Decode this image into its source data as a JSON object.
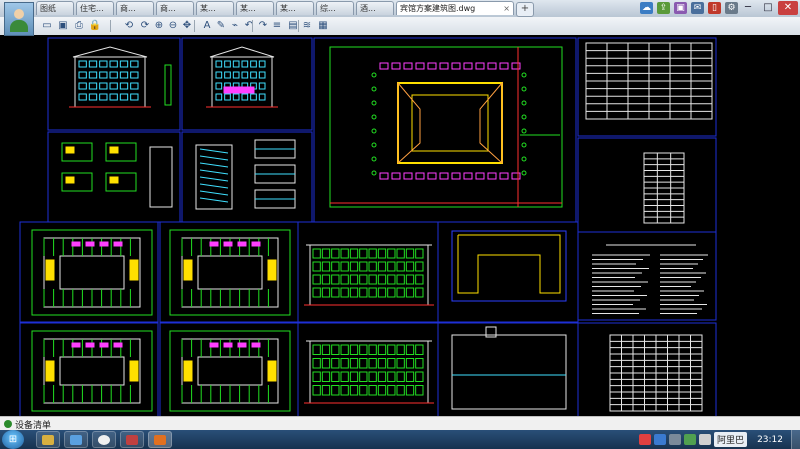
{
  "window": {
    "tabs": [
      "图纸",
      "住宅...",
      "商...",
      "商...",
      "某...",
      "某...",
      "某...",
      "综...",
      "酒..."
    ],
    "active_tab": "宾馆方案建筑图.dwg",
    "new_tab": "+",
    "controls": {
      "minimize": "─",
      "maximize": "□",
      "close": "✕"
    }
  },
  "toolbar": {
    "icons": [
      "open-icon",
      "save-icon",
      "print-icon",
      "lock-icon",
      "rotate-icon",
      "rotate-right-icon",
      "zoom-in-icon",
      "zoom-out-icon",
      "pan-icon",
      "text-icon",
      "pencil-icon",
      "brush-icon",
      "undo-icon",
      "redo-icon",
      "layer-icon",
      "layout-icon",
      "measure-icon",
      "block-icon"
    ],
    "glyphs": [
      "▭",
      "▣",
      "⎙",
      "🔒",
      "⟲",
      "⟳",
      "⊕",
      "⊖",
      "✥",
      "A",
      "✎",
      "⌁",
      "↶",
      "↷",
      "≡",
      "▤",
      "≋",
      "▦"
    ]
  },
  "drawing": {
    "background": "#000000",
    "border_color": "#1e2fd6",
    "line_colors": {
      "green": "#22e022",
      "white": "#e6e6e6",
      "yellow": "#ffe000",
      "magenta": "#ff40ff",
      "cyan": "#40e0ff",
      "red": "#ff3030",
      "blue": "#2c40ff",
      "orange": "#ffa040"
    }
  },
  "status": {
    "text": "设备清单"
  },
  "taskbar": {
    "start": "⊞",
    "ime_label": "阿里巴",
    "time": "23:12"
  }
}
